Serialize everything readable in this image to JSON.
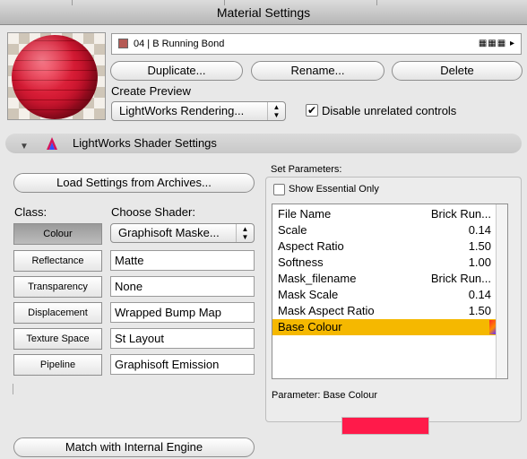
{
  "window": {
    "title": "Material Settings"
  },
  "material": {
    "name": "04 | B Running Bond"
  },
  "buttons": {
    "duplicate": "Duplicate...",
    "rename": "Rename...",
    "delete": "Delete",
    "load_settings": "Load Settings from Archives...",
    "match_engine": "Match with Internal Engine"
  },
  "preview": {
    "label": "Create Preview",
    "renderer": "LightWorks Rendering...",
    "disable_unrelated_label": "Disable unrelated controls",
    "disable_unrelated_checked": "✔"
  },
  "shader_section": {
    "title": "LightWorks Shader Settings"
  },
  "class_section": {
    "class_label": "Class:",
    "choose_label": "Choose Shader:",
    "classes": [
      "Colour",
      "Reflectance",
      "Transparency",
      "Displacement",
      "Texture Space",
      "Pipeline"
    ],
    "selected_class": "Colour",
    "shaders": [
      "Graphisoft Maske...",
      "Matte",
      "None",
      "Wrapped Bump Map",
      "St Layout",
      "Graphisoft Emission"
    ]
  },
  "parameters": {
    "group_label": "Set Parameters:",
    "show_essential_label": "Show Essential Only",
    "rows": [
      {
        "name": "File Name",
        "value": "Brick Run..."
      },
      {
        "name": "Scale",
        "value": "0.14"
      },
      {
        "name": "Aspect Ratio",
        "value": "1.50"
      },
      {
        "name": "Softness",
        "value": "1.00"
      },
      {
        "name": "Mask_filename",
        "value": "Brick Run..."
      },
      {
        "name": "Mask Scale",
        "value": "0.14"
      },
      {
        "name": "Mask Aspect Ratio",
        "value": "1.50"
      },
      {
        "name": "Base Colour",
        "value": ""
      }
    ],
    "selected_row": "Base Colour",
    "current_label": "Parameter: Base Colour",
    "current_colour": "#ff1a4a"
  },
  "colors": {
    "selection": "#f5b800",
    "swatch": "#ff1a4a"
  }
}
